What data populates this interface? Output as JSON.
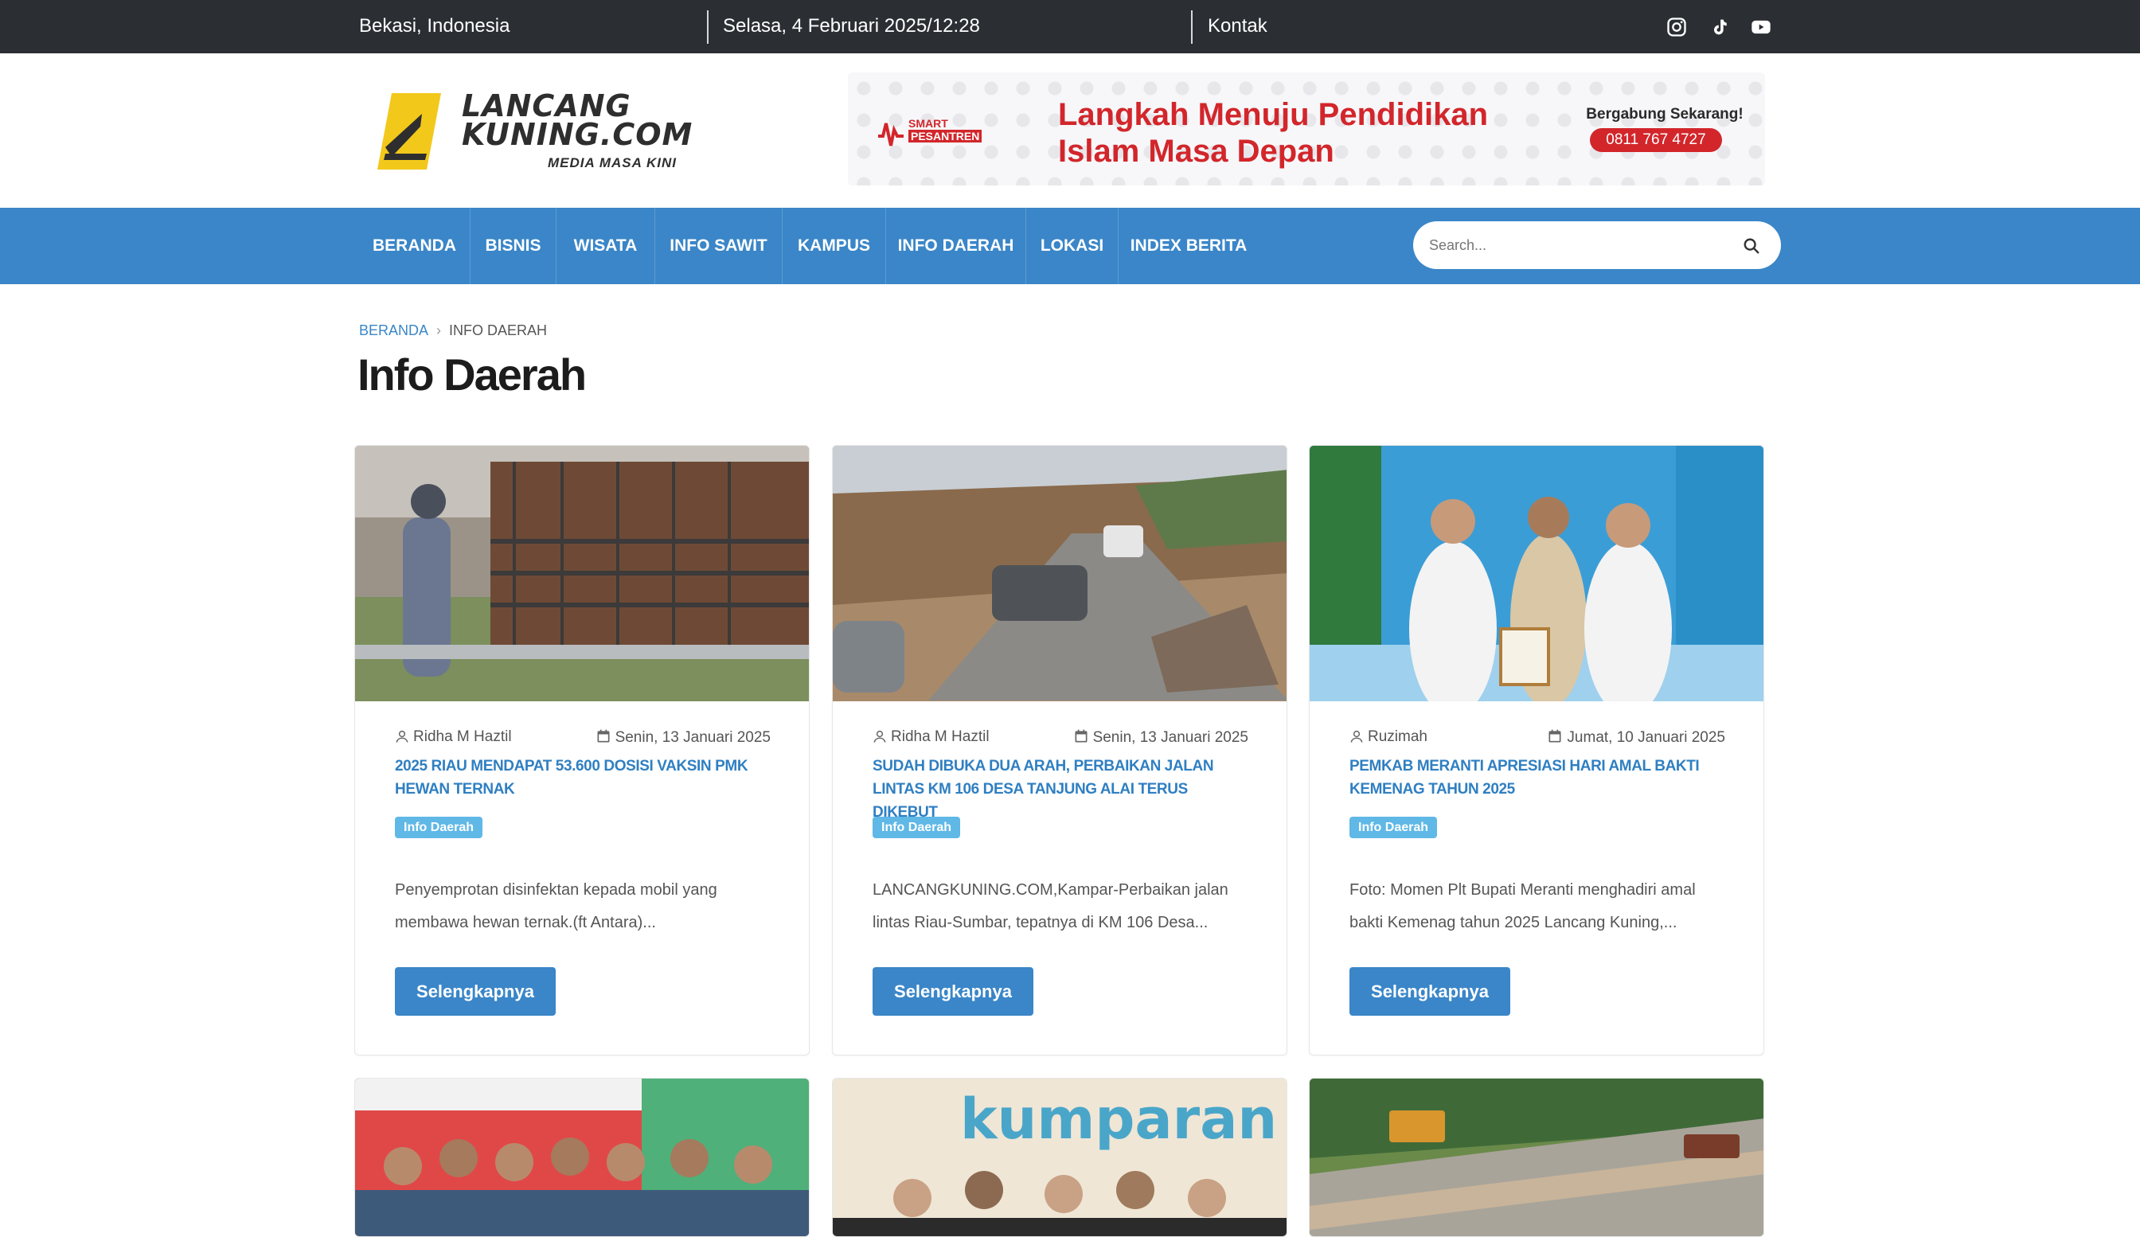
{
  "topbar": {
    "location": "Bekasi, Indonesia",
    "datetime": "Selasa, 4 Februari 2025/12:28",
    "contact": "Kontak",
    "social_icons": [
      "instagram-icon",
      "tiktok-icon",
      "youtube-icon"
    ]
  },
  "logo": {
    "line1": "LANCANG",
    "line2": "KUNING.COM",
    "tagline": "MEDIA MASA KINI"
  },
  "banner": {
    "brand_line1": "SMART",
    "brand_line2": "PESANTREN",
    "title_line1": "Langkah Menuju Pendidikan",
    "title_line2": "Islam Masa Depan",
    "cta": "Bergabung Sekarang!",
    "phone": "0811 767 4727"
  },
  "nav": {
    "items": [
      "BERANDA",
      "BISNIS",
      "WISATA",
      "INFO SAWIT",
      "KAMPUS",
      "INFO DAERAH",
      "LOKASI",
      "INDEX BERITA"
    ],
    "search_placeholder": "Search..."
  },
  "breadcrumb": {
    "home": "BERANDA",
    "current": "INFO DAERAH"
  },
  "page_title": "Info Daerah",
  "articles": [
    {
      "author": "Ridha M Haztil",
      "date": "Senin, 13 Januari 2025",
      "title": "2025 RIAU MENDAPAT 53.600 DOSISI VAKSIN PMK HEWAN TERNAK",
      "category": "Info Daerah",
      "excerpt": "Penyemprotan disinfektan kepada mobil yang membawa hewan ternak.(ft Antara)...",
      "button": "Selengkapnya"
    },
    {
      "author": "Ridha M Haztil",
      "date": "Senin, 13 Januari 2025",
      "title": "SUDAH DIBUKA DUA ARAH, PERBAIKAN JALAN LINTAS KM 106 DESA TANJUNG ALAI TERUS DIKEBUT",
      "category": "Info Daerah",
      "excerpt": "LANCANGKUNING.COM,Kampar-Perbaikan jalan lintas Riau-Sumbar, tepatnya di KM 106 Desa...",
      "button": "Selengkapnya"
    },
    {
      "author": "Ruzimah",
      "date": "Jumat, 10 Januari 2025",
      "title": "PEMKAB MERANTI APRESIASI HARI AMAL BAKTI KEMENAG TAHUN 2025",
      "category": "Info Daerah",
      "excerpt": "Foto: Momen Plt Bupati Meranti menghadiri amal bakti Kemenag tahun 2025 Lancang Kuning,...",
      "button": "Selengkapnya"
    }
  ],
  "colors": {
    "topbar_bg": "#2b2f33",
    "nav_bg": "#3a86c8",
    "link_blue": "#2f7fc2",
    "badge": "#5fb8e6",
    "banner_red": "#d2262b",
    "logo_yellow": "#f2c81b"
  }
}
